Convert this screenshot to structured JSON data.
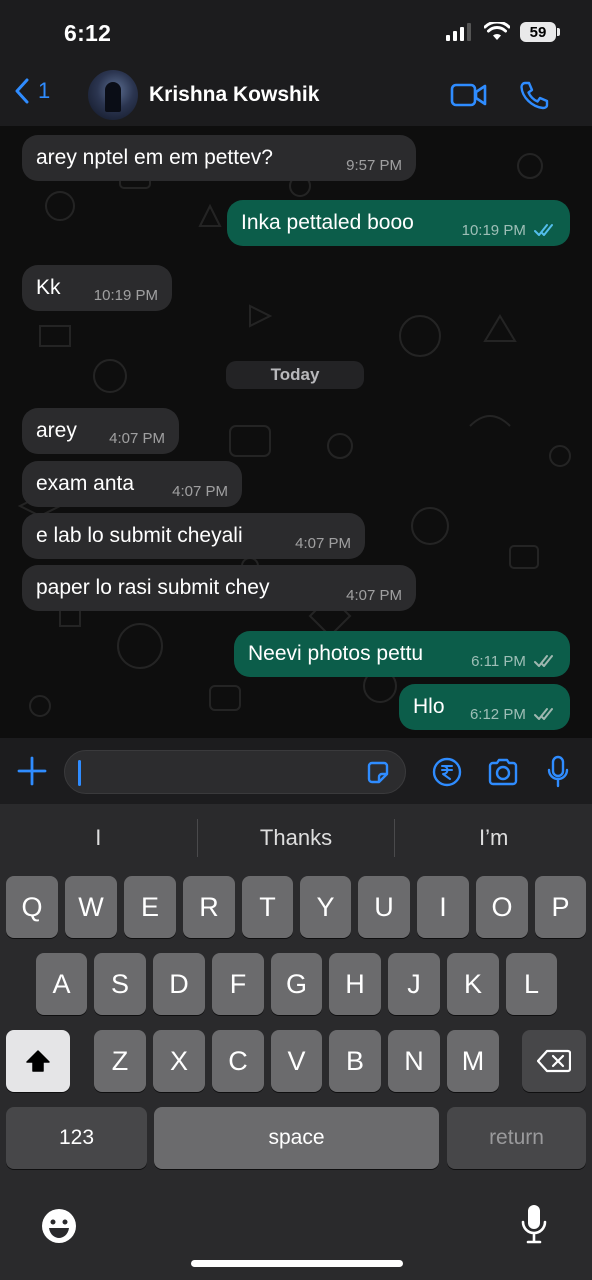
{
  "status": {
    "time": "6:12",
    "battery": "59"
  },
  "header": {
    "back_count": "1",
    "contact_name": "Krishna Kowshik",
    "icons": [
      "chevron-left-icon",
      "video-call-icon",
      "phone-icon"
    ]
  },
  "messages": [
    {
      "dir": "in",
      "text": "arey nptel em em pettev?",
      "time": "9:57 PM"
    },
    {
      "dir": "out",
      "text": "Inka pettaled booo",
      "time": "10:19 PM",
      "ticks": "read"
    },
    {
      "dir": "in",
      "text": "Kk",
      "time": "10:19 PM"
    },
    {
      "dir": "in",
      "text": "arey",
      "time": "4:07 PM"
    },
    {
      "dir": "in",
      "text": "exam anta",
      "time": "4:07 PM"
    },
    {
      "dir": "in",
      "text": "e lab lo submit cheyali",
      "time": "4:07 PM"
    },
    {
      "dir": "in",
      "text": "paper lo rasi submit chey",
      "time": "4:07 PM"
    },
    {
      "dir": "out",
      "text": "Neevi photos pettu",
      "time": "6:11 PM",
      "ticks": "delivered"
    },
    {
      "dir": "out",
      "text": "Hlo",
      "time": "6:12 PM",
      "ticks": "delivered"
    }
  ],
  "day_separator": "Today",
  "composer": {
    "input_value": "",
    "icons": [
      "plus-icon",
      "sticker-icon",
      "rupee-icon",
      "camera-icon",
      "microphone-icon"
    ]
  },
  "keyboard": {
    "suggestions": [
      "I",
      "Thanks",
      "I’m"
    ],
    "row1": [
      "Q",
      "W",
      "E",
      "R",
      "T",
      "Y",
      "U",
      "I",
      "O",
      "P"
    ],
    "row2": [
      "A",
      "S",
      "D",
      "F",
      "G",
      "H",
      "J",
      "K",
      "L"
    ],
    "row3": [
      "Z",
      "X",
      "C",
      "V",
      "B",
      "N",
      "M"
    ],
    "numbers_label": "123",
    "space_label": "space",
    "return_label": "return"
  },
  "colors": {
    "accent": "#2f8cff",
    "incoming_bubble": "#2b2b2d",
    "outgoing_bubble": "#0c5d4a",
    "read_tick": "#53bdeb"
  }
}
